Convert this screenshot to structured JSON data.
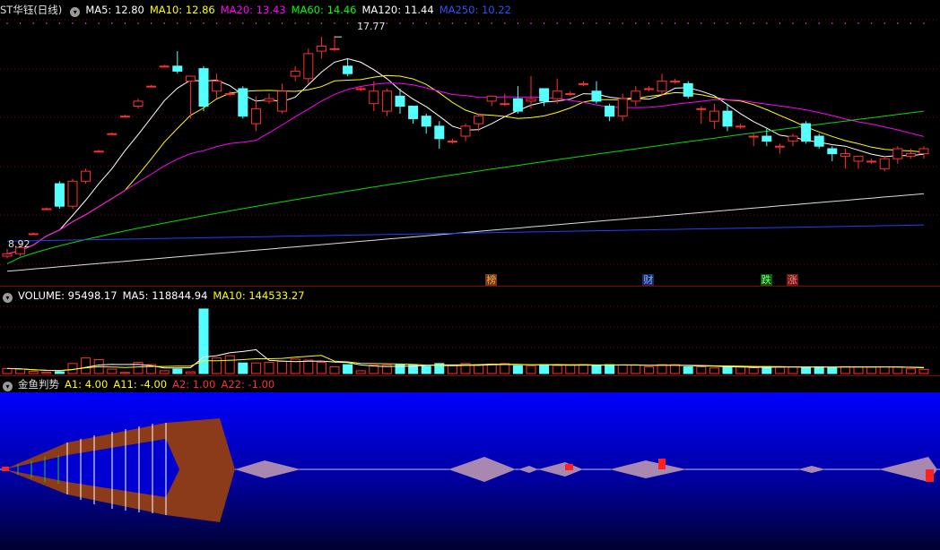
{
  "main": {
    "stock_name": "ST华钰(日线)",
    "ma_legend": [
      {
        "label": "MA5: 12.80",
        "color": "#ffffff"
      },
      {
        "label": "MA10: 12.86",
        "color": "#ffff00"
      },
      {
        "label": "MA20: 13.43",
        "color": "#ff00ff"
      },
      {
        "label": "MA60: 14.46",
        "color": "#00ff00"
      },
      {
        "label": "MA120: 11.44",
        "color": "#ffffff"
      },
      {
        "label": "MA250: 10.22",
        "color": "#3050ff"
      }
    ],
    "high_label": "17.77",
    "low_label": "8.92",
    "event_tags": [
      {
        "text": "榜",
        "bg": "#6b3a1a",
        "color": "#ffa040"
      },
      {
        "text": "财",
        "bg": "#1a2a6b",
        "color": "#80b0ff"
      },
      {
        "text": "跌",
        "bg": "#0a5a0a",
        "color": "#80ff80"
      },
      {
        "text": "涨",
        "bg": "#6b1a1a",
        "color": "#ff8080"
      }
    ]
  },
  "volume": {
    "legend": [
      {
        "label": "VOLUME: 95498.17",
        "color": "#ffffff"
      },
      {
        "label": "MA5: 118844.94",
        "color": "#ffffff"
      },
      {
        "label": "MA10: 144533.27",
        "color": "#ffff00"
      }
    ]
  },
  "indicator": {
    "name": "金鱼判势",
    "legend": [
      {
        "label": "A1: 4.00",
        "color": "#ffff00"
      },
      {
        "label": "A11: -4.00",
        "color": "#ffff00"
      },
      {
        "label": "A2: 1.00",
        "color": "#ff3030"
      },
      {
        "label": "A22: -1.00",
        "color": "#ff3030"
      }
    ]
  },
  "colors": {
    "up": "#ff3030",
    "down": "#54ffff",
    "grid": "#8a0000",
    "ma5": "#ffffff",
    "ma10": "#ffff00",
    "ma20": "#ff00ff",
    "ma60": "#00dd00",
    "ma120": "#dddddd",
    "ma250": "#2040ff",
    "fish": "#8b3a1a",
    "pink": "#a888b0"
  },
  "chart_data": {
    "type": "candlestick",
    "price_range": [
      8.5,
      18.6
    ],
    "candles": [
      [
        9.0,
        9.1,
        8.92,
        9.3
      ],
      [
        9.1,
        9.35,
        9.0,
        9.5
      ],
      [
        9.9,
        9.9,
        9.85,
        9.95
      ],
      [
        10.9,
        10.9,
        10.85,
        10.95
      ],
      [
        11.9,
        11.0,
        10.9,
        12.0
      ],
      [
        11.0,
        12.0,
        10.9,
        12.1
      ],
      [
        12.0,
        12.4,
        11.9,
        12.5
      ],
      [
        13.2,
        13.2,
        13.15,
        13.25
      ],
      [
        13.9,
        13.9,
        13.85,
        13.95
      ],
      [
        14.6,
        14.6,
        14.55,
        14.65
      ],
      [
        15.0,
        15.2,
        14.9,
        15.3
      ],
      [
        15.8,
        15.8,
        15.75,
        15.85
      ],
      [
        16.6,
        16.6,
        16.55,
        16.65
      ],
      [
        16.6,
        16.4,
        16.3,
        17.2
      ],
      [
        16.0,
        16.2,
        14.5,
        16.2
      ],
      [
        16.5,
        15.0,
        14.8,
        16.6
      ],
      [
        15.6,
        16.0,
        15.3,
        16.3
      ],
      [
        15.5,
        15.5,
        15.4,
        15.6
      ],
      [
        15.7,
        14.6,
        14.5,
        15.8
      ],
      [
        14.3,
        14.9,
        14.0,
        15.4
      ],
      [
        15.2,
        15.3,
        15.1,
        15.5
      ],
      [
        14.8,
        15.6,
        14.7,
        15.9
      ],
      [
        16.2,
        16.4,
        16.0,
        16.6
      ],
      [
        16.1,
        17.1,
        15.9,
        17.3
      ],
      [
        17.2,
        17.4,
        16.9,
        17.77
      ],
      [
        17.3,
        17.3,
        17.2,
        17.8
      ],
      [
        16.6,
        16.3,
        16.2,
        16.9
      ],
      [
        15.7,
        15.7,
        15.6,
        15.8
      ],
      [
        15.1,
        15.6,
        14.8,
        16.0
      ],
      [
        14.8,
        15.6,
        14.6,
        15.7
      ],
      [
        15.4,
        15.0,
        14.7,
        15.7
      ],
      [
        15.0,
        14.5,
        14.3,
        15.0
      ],
      [
        14.6,
        14.2,
        13.9,
        14.7
      ],
      [
        14.2,
        13.7,
        13.3,
        14.4
      ],
      [
        13.6,
        13.6,
        13.5,
        13.7
      ],
      [
        13.8,
        14.2,
        13.6,
        14.3
      ],
      [
        14.3,
        14.6,
        14.0,
        14.7
      ],
      [
        15.2,
        15.4,
        15.0,
        15.4
      ],
      [
        15.1,
        15.1,
        15.0,
        15.5
      ],
      [
        15.3,
        14.8,
        14.7,
        15.8
      ],
      [
        15.2,
        15.3,
        14.9,
        16.2
      ],
      [
        15.7,
        15.2,
        15.0,
        15.7
      ],
      [
        15.3,
        15.6,
        15.1,
        16.1
      ],
      [
        15.5,
        15.5,
        15.4,
        15.6
      ],
      [
        15.9,
        15.9,
        15.8,
        16.0
      ],
      [
        15.6,
        15.2,
        15.1,
        16.0
      ],
      [
        15.0,
        14.6,
        14.4,
        15.1
      ],
      [
        14.6,
        15.3,
        14.4,
        15.5
      ],
      [
        15.2,
        15.6,
        15.0,
        15.8
      ],
      [
        15.7,
        15.7,
        15.6,
        15.8
      ],
      [
        15.6,
        16.0,
        15.4,
        16.3
      ],
      [
        16.0,
        16.0,
        15.9,
        16.1
      ],
      [
        15.9,
        15.4,
        15.3,
        16.0
      ],
      [
        14.9,
        14.9,
        14.3,
        15.0
      ],
      [
        14.4,
        14.8,
        14.1,
        15.1
      ],
      [
        14.8,
        14.2,
        14.0,
        15.1
      ],
      [
        14.2,
        14.2,
        14.1,
        14.3
      ],
      [
        13.8,
        13.8,
        13.4,
        13.9
      ],
      [
        13.8,
        13.6,
        13.4,
        14.1
      ],
      [
        13.4,
        13.4,
        13.1,
        13.5
      ],
      [
        13.6,
        13.8,
        13.4,
        13.9
      ],
      [
        14.3,
        13.6,
        13.5,
        14.4
      ],
      [
        13.8,
        13.4,
        13.3,
        13.9
      ],
      [
        13.3,
        13.1,
        12.8,
        13.4
      ],
      [
        13.0,
        13.1,
        12.5,
        13.3
      ],
      [
        12.8,
        13.0,
        12.5,
        13.0
      ],
      [
        12.8,
        12.8,
        12.7,
        12.9
      ],
      [
        12.5,
        12.9,
        12.4,
        13.0
      ],
      [
        12.9,
        13.3,
        12.7,
        13.4
      ],
      [
        13.0,
        13.1,
        12.9,
        13.3
      ],
      [
        13.1,
        13.3,
        12.9,
        13.4
      ]
    ],
    "volume_range": [
      0,
      620000
    ],
    "volume": [
      45000,
      40000,
      20000,
      12000,
      16000,
      90000,
      140000,
      125000,
      40000,
      10000,
      100000,
      80000,
      25000,
      40000,
      15000,
      580000,
      140000,
      160000,
      95000,
      95000,
      100000,
      110000,
      130000,
      120000,
      100000,
      60000,
      80000,
      25000,
      75000,
      75000,
      80000,
      75000,
      65000,
      90000,
      75000,
      90000,
      80000,
      85000,
      90000,
      70000,
      70000,
      80000,
      72000,
      78000,
      80000,
      70000,
      80000,
      78000,
      78000,
      60000,
      80000,
      80000,
      60000,
      60000,
      50000,
      56000,
      62000,
      52000,
      62000,
      57000,
      60000,
      58000,
      60000,
      57000,
      62000,
      60000,
      58000,
      60000,
      58000,
      42000,
      38000
    ],
    "markers": [
      {
        "text": "榜",
        "candle": 37
      },
      {
        "text": "财",
        "candle": 49
      },
      {
        "text": "跌",
        "candle": 58
      },
      {
        "text": "涨",
        "candle": 60
      }
    ]
  }
}
